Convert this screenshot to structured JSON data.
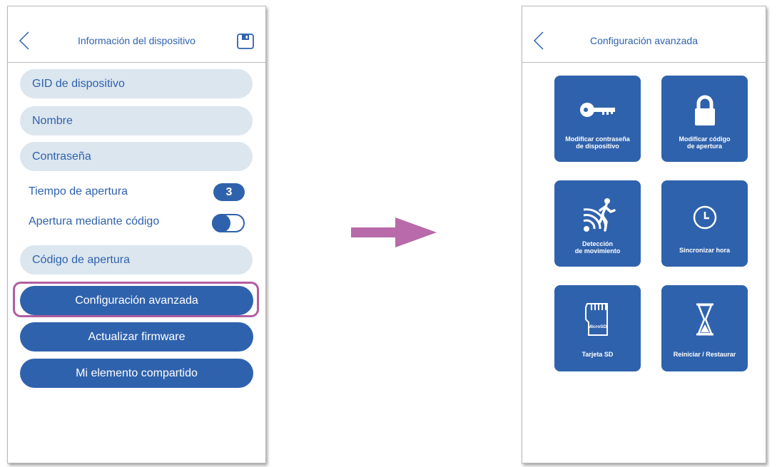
{
  "colors": {
    "primary": "#2f62ad",
    "field_bg": "#dce6ef",
    "highlight": "#b25d9f",
    "arrow": "#b86aaa"
  },
  "left_screen": {
    "title": "Información del dispositivo",
    "back_icon": "chevron-left-icon",
    "save_icon": "floppy-disk-icon",
    "fields": {
      "gid": "GID de dispositivo",
      "name": "Nombre",
      "password": "Contraseña",
      "open_code": "Código de apertura"
    },
    "opening_time": {
      "label": "Tiempo de apertura",
      "value": "3"
    },
    "code_opening": {
      "label": "Apertura mediante código",
      "enabled": true
    },
    "buttons": {
      "advanced": "Configuración avanzada",
      "firmware": "Actualizar firmware",
      "shared": "Mi elemento compartido"
    }
  },
  "arrow_icon": "right-arrow-icon",
  "right_screen": {
    "title": "Configuración avanzada",
    "back_icon": "chevron-left-icon",
    "tiles": [
      {
        "lines": [
          "Modificar contraseña",
          "de dispositivo"
        ],
        "icon": "key-icon"
      },
      {
        "lines": [
          "Modificar código",
          "de apertura"
        ],
        "icon": "lock-icon"
      },
      {
        "lines": [
          "Detección",
          "de movimiento"
        ],
        "icon": "motion-sensor-icon"
      },
      {
        "lines": [
          "Sincronizar hora"
        ],
        "icon": "clock-icon"
      },
      {
        "lines": [
          "Tarjeta SD"
        ],
        "icon": "microsd-card-icon",
        "icon_text": "MicroSD"
      },
      {
        "lines": [
          "Reiniciar / Restaurar"
        ],
        "icon": "hourglass-icon"
      }
    ]
  }
}
